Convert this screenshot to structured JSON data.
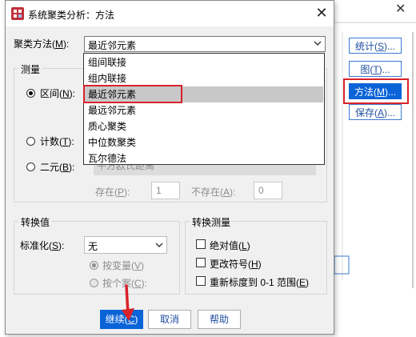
{
  "background_window": {
    "buttons": [
      {
        "label": "统计(S)...",
        "text": "统计(",
        "key": "S",
        "rest": ")..."
      },
      {
        "label": "图(T)...",
        "text": "图(",
        "key": "T",
        "rest": ")..."
      },
      {
        "label": "方法(M)...",
        "text": "方法(",
        "key": "M",
        "rest": ")..."
      },
      {
        "label": "保存(A)...",
        "text": "保存(",
        "key": "A",
        "rest": ")..."
      }
    ]
  },
  "dialog": {
    "title": "系统聚类分析：方法",
    "cluster_method": {
      "label_text": "聚类方法(",
      "label_key": "M",
      "label_rest": "):",
      "selected": "最近邻元素",
      "options": [
        "组间联接",
        "组内联接",
        "最近邻元素",
        "最远邻元素",
        "质心聚类",
        "中位数聚类",
        "瓦尔德法"
      ],
      "highlighted_index": 2
    },
    "measure": {
      "title": "测量",
      "interval": {
        "text": "区间(",
        "key": "N",
        "rest": "):"
      },
      "count": {
        "text": "计数(",
        "key": "T",
        "rest": "):"
      },
      "binary": {
        "text": "二元(",
        "key": "B",
        "rest": "):"
      },
      "binary_measure_fragment": "平方欧氏距离",
      "present": {
        "text": "存在(",
        "key": "P",
        "rest": "):",
        "value": "1"
      },
      "absent": {
        "text": "不存在(",
        "key": "A",
        "rest": "):",
        "value": "0"
      }
    },
    "transform_values": {
      "title": "转换值",
      "standardize": {
        "text": "标准化(",
        "key": "S",
        "rest": "):",
        "value": "无"
      },
      "by_variable": {
        "text": "按变量(",
        "key": "V",
        "rest": ")"
      },
      "by_case": {
        "text": "按个案(",
        "key": "C",
        "rest": "):"
      }
    },
    "transform_measures": {
      "title": "转换测量",
      "absolute": {
        "text": "绝对值(",
        "key": "L",
        "rest": ")"
      },
      "change_sign": {
        "text": "更改符号(",
        "key": "H",
        "rest": ")"
      },
      "rescale": {
        "text": "重新标度到 0-1 范围(",
        "key": "E",
        "rest": ")"
      }
    },
    "buttons": {
      "continue": {
        "text": "继续(",
        "key": "C",
        "rest": ")"
      },
      "cancel": "取消",
      "help": "帮助"
    }
  },
  "colors": {
    "accent": "#0a64d8",
    "highlight_box": "#d8222a",
    "selection": "#c8c8c8"
  }
}
